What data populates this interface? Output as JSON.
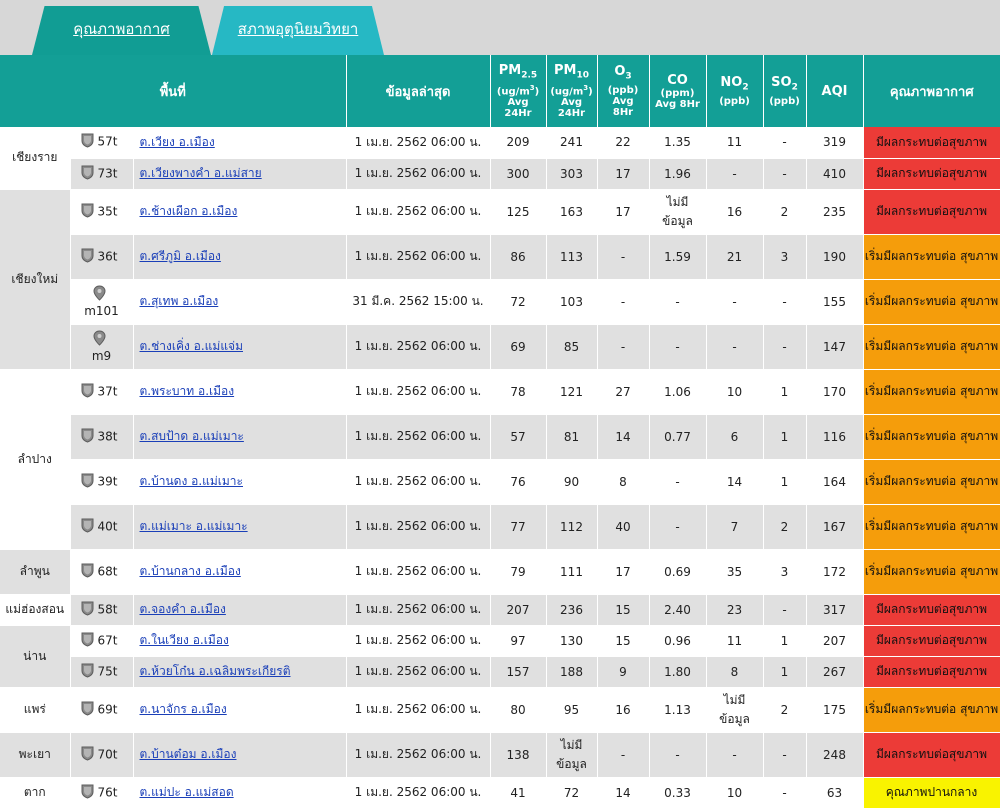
{
  "tabs": [
    {
      "label": "คุณภาพอากาศ"
    },
    {
      "label": "สภาพอุตุนิยมวิทยา"
    }
  ],
  "headers": {
    "area": "พื้นที่",
    "latest": "ข้อมูลล่าสุด",
    "pm25": {
      "name": "PM",
      "sub": "2.5",
      "unit1": "(ug/m",
      "unit1sup": "3",
      "unit1end": ")",
      "avg": "Avg",
      "hr": "24Hr"
    },
    "pm10": {
      "name": "PM",
      "sub": "10",
      "unit1": "(ug/m",
      "unit1sup": "3",
      "unit1end": ")",
      "avg": "Avg",
      "hr": "24Hr"
    },
    "o3": {
      "name": "O",
      "sub": "3",
      "unit": "(ppb)",
      "avg": "Avg",
      "hr": "8Hr"
    },
    "co": {
      "name": "CO",
      "unit": "(ppm)",
      "avg": "Avg 8Hr"
    },
    "no2": {
      "name": "NO",
      "sub": "2",
      "unit": "(ppb)"
    },
    "so2": {
      "name": "SO",
      "sub": "2",
      "unit": "(ppb)"
    },
    "aqi": "AQI",
    "quality": "คุณภาพอากาศ"
  },
  "rows": [
    {
      "province": "เชียงราย",
      "rowspan": 2,
      "station": "57t",
      "icon": "shield",
      "area": "ต.เวียง อ.เมือง",
      "date": "1 เม.ย. 2562 06:00 น.",
      "pm25": "209",
      "pm10": "241",
      "o3": "22",
      "co": "1.35",
      "no2": "11",
      "so2": "-",
      "aqi": "319",
      "quality": "มีผลกระทบต่อสุขภาพ",
      "level": "red",
      "h": 31
    },
    {
      "station": "73t",
      "icon": "shield",
      "area": "ต.เวียงพางคำ อ.แม่สาย",
      "date": "1 เม.ย. 2562 06:00 น.",
      "pm25": "300",
      "pm10": "303",
      "o3": "17",
      "co": "1.96",
      "no2": "-",
      "so2": "-",
      "aqi": "410",
      "quality": "มีผลกระทบต่อสุขภาพ",
      "level": "red",
      "h": 31
    },
    {
      "province": "เชียงใหม่",
      "rowspan": 4,
      "station": "35t",
      "icon": "shield",
      "area": "ต.ช้างเผือก อ.เมือง",
      "date": "1 เม.ย. 2562 06:00 น.",
      "pm25": "125",
      "pm10": "163",
      "o3": "17",
      "co": "ไม่มี ข้อมูล",
      "no2": "16",
      "so2": "2",
      "aqi": "235",
      "quality": "มีผลกระทบต่อสุขภาพ",
      "level": "red",
      "h": 45
    },
    {
      "station": "36t",
      "icon": "shield",
      "area": "ต.ศรีภูมิ อ.เมือง",
      "date": "1 เม.ย. 2562 06:00 น.",
      "pm25": "86",
      "pm10": "113",
      "o3": "-",
      "co": "1.59",
      "no2": "21",
      "so2": "3",
      "aqi": "190",
      "quality": "เริ่มมีผลกระทบต่อ สุขภาพ",
      "level": "orange",
      "h": 45
    },
    {
      "station": "m101",
      "icon": "pin",
      "area": "ต.สุเทพ อ.เมือง",
      "date": "31 มี.ค. 2562 15:00 น.",
      "pm25": "72",
      "pm10": "103",
      "o3": "-",
      "co": "-",
      "no2": "-",
      "so2": "-",
      "aqi": "155",
      "quality": "เริ่มมีผลกระทบต่อ สุขภาพ",
      "level": "orange",
      "h": 45
    },
    {
      "station": "m9",
      "icon": "pin",
      "area": "ต.ช่างเคิ่ง อ.แม่แจ่ม",
      "date": "1 เม.ย. 2562 06:00 น.",
      "pm25": "69",
      "pm10": "85",
      "o3": "-",
      "co": "-",
      "no2": "-",
      "so2": "-",
      "aqi": "147",
      "quality": "เริ่มมีผลกระทบต่อ สุขภาพ",
      "level": "orange",
      "h": 45
    },
    {
      "province": "ลำปาง",
      "rowspan": 4,
      "station": "37t",
      "icon": "shield",
      "area": "ต.พระบาท อ.เมือง",
      "date": "1 เม.ย. 2562 06:00 น.",
      "pm25": "78",
      "pm10": "121",
      "o3": "27",
      "co": "1.06",
      "no2": "10",
      "so2": "1",
      "aqi": "170",
      "quality": "เริ่มมีผลกระทบต่อ สุขภาพ",
      "level": "orange",
      "h": 45
    },
    {
      "station": "38t",
      "icon": "shield",
      "area": "ต.สบป้าด อ.แม่เมาะ",
      "date": "1 เม.ย. 2562 06:00 น.",
      "pm25": "57",
      "pm10": "81",
      "o3": "14",
      "co": "0.77",
      "no2": "6",
      "so2": "1",
      "aqi": "116",
      "quality": "เริ่มมีผลกระทบต่อ สุขภาพ",
      "level": "orange",
      "h": 45
    },
    {
      "station": "39t",
      "icon": "shield",
      "area": "ต.บ้านดง อ.แม่เมาะ",
      "date": "1 เม.ย. 2562 06:00 น.",
      "pm25": "76",
      "pm10": "90",
      "o3": "8",
      "co": "-",
      "no2": "14",
      "so2": "1",
      "aqi": "164",
      "quality": "เริ่มมีผลกระทบต่อ สุขภาพ",
      "level": "orange",
      "h": 45
    },
    {
      "station": "40t",
      "icon": "shield",
      "area": "ต.แม่เมาะ อ.แม่เมาะ",
      "date": "1 เม.ย. 2562 06:00 น.",
      "pm25": "77",
      "pm10": "112",
      "o3": "40",
      "co": "-",
      "no2": "7",
      "so2": "2",
      "aqi": "167",
      "quality": "เริ่มมีผลกระทบต่อ สุขภาพ",
      "level": "orange",
      "h": 45
    },
    {
      "province": "ลำพูน",
      "rowspan": 1,
      "station": "68t",
      "icon": "shield",
      "area": "ต.บ้านกลาง อ.เมือง",
      "date": "1 เม.ย. 2562 06:00 น.",
      "pm25": "79",
      "pm10": "111",
      "o3": "17",
      "co": "0.69",
      "no2": "35",
      "so2": "3",
      "aqi": "172",
      "quality": "เริ่มมีผลกระทบต่อ สุขภาพ",
      "level": "orange",
      "h": 45
    },
    {
      "province": "แม่ฮ่องสอน",
      "rowspan": 1,
      "station": "58t",
      "icon": "shield",
      "area": "ต.จองคำ อ.เมือง",
      "date": "1 เม.ย. 2562 06:00 น.",
      "pm25": "207",
      "pm10": "236",
      "o3": "15",
      "co": "2.40",
      "no2": "23",
      "so2": "-",
      "aqi": "317",
      "quality": "มีผลกระทบต่อสุขภาพ",
      "level": "red",
      "h": 31
    },
    {
      "province": "น่าน",
      "rowspan": 2,
      "station": "67t",
      "icon": "shield",
      "area": "ต.ในเวียง อ.เมือง",
      "date": "1 เม.ย. 2562 06:00 น.",
      "pm25": "97",
      "pm10": "130",
      "o3": "15",
      "co": "0.96",
      "no2": "11",
      "so2": "1",
      "aqi": "207",
      "quality": "มีผลกระทบต่อสุขภาพ",
      "level": "red",
      "h": 31
    },
    {
      "station": "75t",
      "icon": "shield",
      "area": "ต.ห้วยโก๋น อ.เฉลิมพระเกียรติ",
      "date": "1 เม.ย. 2562 06:00 น.",
      "pm25": "157",
      "pm10": "188",
      "o3": "9",
      "co": "1.80",
      "no2": "8",
      "so2": "1",
      "aqi": "267",
      "quality": "มีผลกระทบต่อสุขภาพ",
      "level": "red",
      "h": 31
    },
    {
      "province": "แพร่",
      "rowspan": 1,
      "station": "69t",
      "icon": "shield",
      "area": "ต.นาจักร อ.เมือง",
      "date": "1 เม.ย. 2562 06:00 น.",
      "pm25": "80",
      "pm10": "95",
      "o3": "16",
      "co": "1.13",
      "no2": "ไม่มี ข้อมูล",
      "so2": "2",
      "aqi": "175",
      "quality": "เริ่มมีผลกระทบต่อ สุขภาพ",
      "level": "orange",
      "h": 45
    },
    {
      "province": "พะเยา",
      "rowspan": 1,
      "station": "70t",
      "icon": "shield",
      "area": "ต.บ้านต๋อม อ.เมือง",
      "date": "1 เม.ย. 2562 06:00 น.",
      "pm25": "138",
      "pm10": "ไม่มี ข้อมูล",
      "o3": "-",
      "co": "-",
      "no2": "-",
      "so2": "-",
      "aqi": "248",
      "quality": "มีผลกระทบต่อสุขภาพ",
      "level": "red",
      "h": 45
    },
    {
      "province": "ตาก",
      "rowspan": 1,
      "station": "76t",
      "icon": "shield",
      "area": "ต.แม่ปะ อ.แม่สอด",
      "date": "1 เม.ย. 2562 06:00 น.",
      "pm25": "41",
      "pm10": "72",
      "o3": "14",
      "co": "0.33",
      "no2": "10",
      "so2": "-",
      "aqi": "63",
      "quality": "คุณภาพปานกลาง",
      "level": "yellow",
      "h": 31
    }
  ],
  "colors": {
    "teal": "#139f96",
    "tab_active": "#119d94",
    "tab_inactive": "#26b8c4",
    "red": "#ec3b37",
    "orange": "#f59d0b",
    "yellow": "#f9f300",
    "link": "#1a3fb8"
  }
}
